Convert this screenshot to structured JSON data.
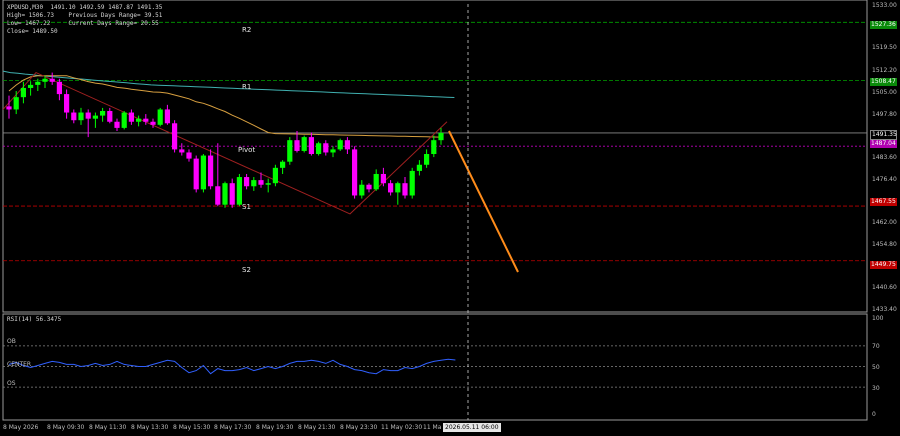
{
  "info": {
    "line1": "XPDUSD,M30  1491.10 1492.59 1487.87 1491.35",
    "line2": "High= 1506.73    Previous Days Range= 39.51",
    "line3": "Low= 1467.22     Current Days Range= 20.55",
    "line4": "Close= 1489.50"
  },
  "levels": {
    "r2": "R2",
    "r1": "R1",
    "pivot": "Pivot",
    "s1": "S1",
    "s2": "S2"
  },
  "price_axis": [
    "1533.00",
    "1519.50",
    "1512.20",
    "1505.00",
    "1497.80",
    "1483.60",
    "1476.40",
    "1462.00",
    "1454.80",
    "1440.60",
    "1433.40"
  ],
  "price_tags": {
    "r2": "1527.36",
    "r1": "1508.47",
    "current": "1491.35",
    "pivot": "1487.04",
    "s1": "1467.55",
    "s2": "1449.75"
  },
  "rsi": {
    "title": "RSI(14) 56.3475",
    "ob": "OB",
    "center": "CENTER",
    "os": "OS",
    "axis": [
      "100",
      "70",
      "50",
      "30",
      "0"
    ]
  },
  "time_axis": [
    "8 May 2026",
    "8 May 09:30",
    "8 May 11:30",
    "8 May 13:30",
    "8 May 15:30",
    "8 May 17:30",
    "8 May 19:30",
    "8 May 21:30",
    "8 May 23:30",
    "11 May 02:30",
    "11 Ma"
  ],
  "time_cursor": "2026.05.11 06:00",
  "colors": {
    "bull": "#00ff00",
    "bear": "#ff00ff",
    "r_line": "#00a000",
    "s_line": "#c00000",
    "pivot_line": "#c000c0",
    "ma_fast": "#d8a040",
    "ma_slow": "#40b0b0",
    "zigzag": "#a02020",
    "projection": "#ff8c1a",
    "rsi_line": "#3060ff"
  },
  "candles": [
    [
      1500.0,
      1503.5,
      1496.0,
      1499.0
    ],
    [
      1499.0,
      1505.0,
      1497.5,
      1503.0
    ],
    [
      1503.0,
      1508.0,
      1501.0,
      1506.0
    ],
    [
      1506.0,
      1508.2,
      1503.5,
      1507.0
    ],
    [
      1507.0,
      1509.0,
      1505.0,
      1508.0
    ],
    [
      1508.0,
      1510.0,
      1506.0,
      1509.0
    ],
    [
      1509.0,
      1511.0,
      1507.0,
      1508.0
    ],
    [
      1508.0,
      1509.0,
      1502.0,
      1504.0
    ],
    [
      1504.0,
      1505.5,
      1496.0,
      1498.0
    ],
    [
      1498.0,
      1499.0,
      1494.5,
      1495.5
    ],
    [
      1495.5,
      1499.5,
      1494.0,
      1498.0
    ],
    [
      1498.0,
      1499.0,
      1490.0,
      1496.0
    ],
    [
      1496.0,
      1498.0,
      1493.0,
      1497.0
    ],
    [
      1497.0,
      1499.5,
      1495.0,
      1498.5
    ],
    [
      1498.5,
      1499.5,
      1494.5,
      1495.0
    ],
    [
      1495.0,
      1496.0,
      1492.0,
      1493.0
    ],
    [
      1493.0,
      1498.5,
      1492.5,
      1498.0
    ],
    [
      1498.0,
      1499.0,
      1494.0,
      1495.0
    ],
    [
      1495.0,
      1497.0,
      1493.5,
      1496.0
    ],
    [
      1496.0,
      1497.5,
      1494.0,
      1495.0
    ],
    [
      1495.0,
      1496.0,
      1493.0,
      1494.0
    ],
    [
      1494.0,
      1499.5,
      1493.5,
      1499.0
    ],
    [
      1499.0,
      1500.5,
      1494.0,
      1494.5
    ],
    [
      1494.5,
      1495.5,
      1485.0,
      1486.0
    ],
    [
      1486.0,
      1488.0,
      1484.0,
      1485.0
    ],
    [
      1485.0,
      1486.0,
      1482.0,
      1483.0
    ],
    [
      1483.0,
      1484.0,
      1472.0,
      1473.0
    ],
    [
      1473.0,
      1484.5,
      1472.0,
      1484.0
    ],
    [
      1484.0,
      1486.0,
      1473.0,
      1474.0
    ],
    [
      1474.0,
      1488.0,
      1467.5,
      1468.0
    ],
    [
      1468.0,
      1475.5,
      1467.0,
      1475.0
    ],
    [
      1475.0,
      1476.5,
      1467.0,
      1468.0
    ],
    [
      1468.0,
      1478.0,
      1467.5,
      1477.0
    ],
    [
      1477.0,
      1478.0,
      1473.0,
      1474.0
    ],
    [
      1474.0,
      1477.0,
      1472.5,
      1476.0
    ],
    [
      1476.0,
      1478.5,
      1473.5,
      1474.5
    ],
    [
      1474.5,
      1476.5,
      1472.0,
      1475.0
    ],
    [
      1475.0,
      1481.0,
      1474.0,
      1480.0
    ],
    [
      1480.0,
      1482.5,
      1478.0,
      1482.0
    ],
    [
      1482.0,
      1490.0,
      1481.0,
      1489.0
    ],
    [
      1489.0,
      1492.0,
      1485.0,
      1485.5
    ],
    [
      1485.5,
      1490.5,
      1485.0,
      1490.0
    ],
    [
      1490.0,
      1491.5,
      1484.0,
      1484.5
    ],
    [
      1484.5,
      1488.5,
      1484.0,
      1488.0
    ],
    [
      1488.0,
      1489.0,
      1484.0,
      1485.0
    ],
    [
      1485.0,
      1487.0,
      1483.5,
      1486.0
    ],
    [
      1486.0,
      1489.5,
      1485.5,
      1489.0
    ],
    [
      1489.0,
      1490.0,
      1484.5,
      1486.0
    ],
    [
      1486.0,
      1487.0,
      1470.0,
      1471.0
    ],
    [
      1471.0,
      1476.0,
      1470.0,
      1474.5
    ],
    [
      1474.5,
      1475.0,
      1472.0,
      1473.0
    ],
    [
      1473.0,
      1479.5,
      1472.5,
      1478.0
    ],
    [
      1478.0,
      1480.0,
      1474.0,
      1475.0
    ],
    [
      1475.0,
      1476.0,
      1471.0,
      1472.0
    ],
    [
      1472.0,
      1475.5,
      1468.0,
      1475.0
    ],
    [
      1475.0,
      1477.0,
      1470.0,
      1471.0
    ],
    [
      1471.0,
      1480.0,
      1470.0,
      1479.0
    ],
    [
      1479.0,
      1482.5,
      1477.5,
      1481.0
    ],
    [
      1481.0,
      1486.0,
      1480.0,
      1484.5
    ],
    [
      1484.5,
      1490.5,
      1483.5,
      1489.0
    ],
    [
      1489.0,
      1493.0,
      1487.5,
      1491.35
    ]
  ],
  "rsi_values": [
    52,
    54,
    51,
    49,
    51,
    53,
    55,
    54,
    52,
    52,
    50,
    51,
    53,
    51,
    52,
    55,
    52,
    51,
    50,
    50,
    52,
    54,
    56,
    55,
    49,
    44,
    46,
    51,
    43,
    48,
    46,
    46,
    47,
    49,
    46,
    48,
    50,
    48,
    50,
    53,
    55,
    55,
    56,
    55,
    53,
    56,
    52,
    50,
    47,
    46,
    44,
    43,
    47,
    46,
    46,
    49,
    48,
    50,
    53,
    55,
    56,
    57,
    56.3
  ]
}
